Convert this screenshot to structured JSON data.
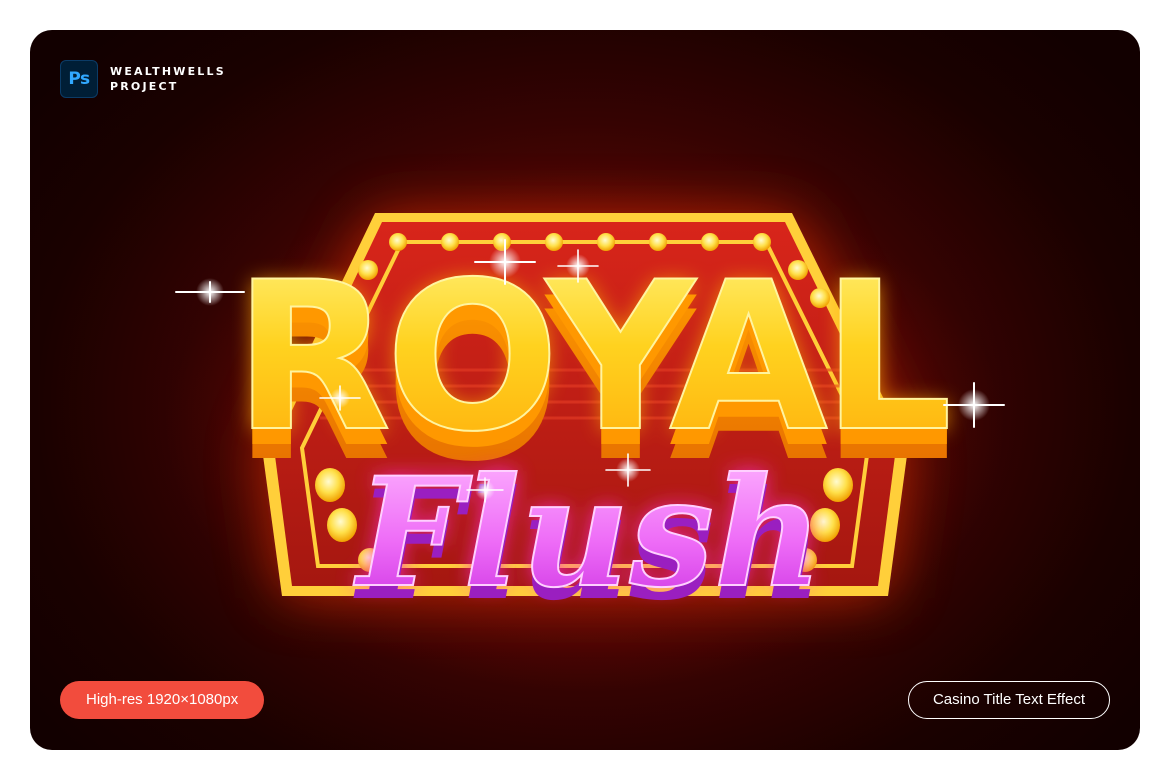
{
  "brand": {
    "logo_text": "Ps",
    "line1": "WEALTHWELLS",
    "line2": "PROJECT"
  },
  "artwork": {
    "title_main": "ROYAL",
    "title_script": "Flush"
  },
  "badges": {
    "resolution": "High-res 1920×1080px",
    "effect_name": "Casino Title Text Effect"
  },
  "colors": {
    "background_dark": "#120000",
    "background_glow": "#7a0a06",
    "gold": "#ffc21a",
    "neon_pink": "#e85cf5",
    "accent_badge": "#f24c3d"
  }
}
